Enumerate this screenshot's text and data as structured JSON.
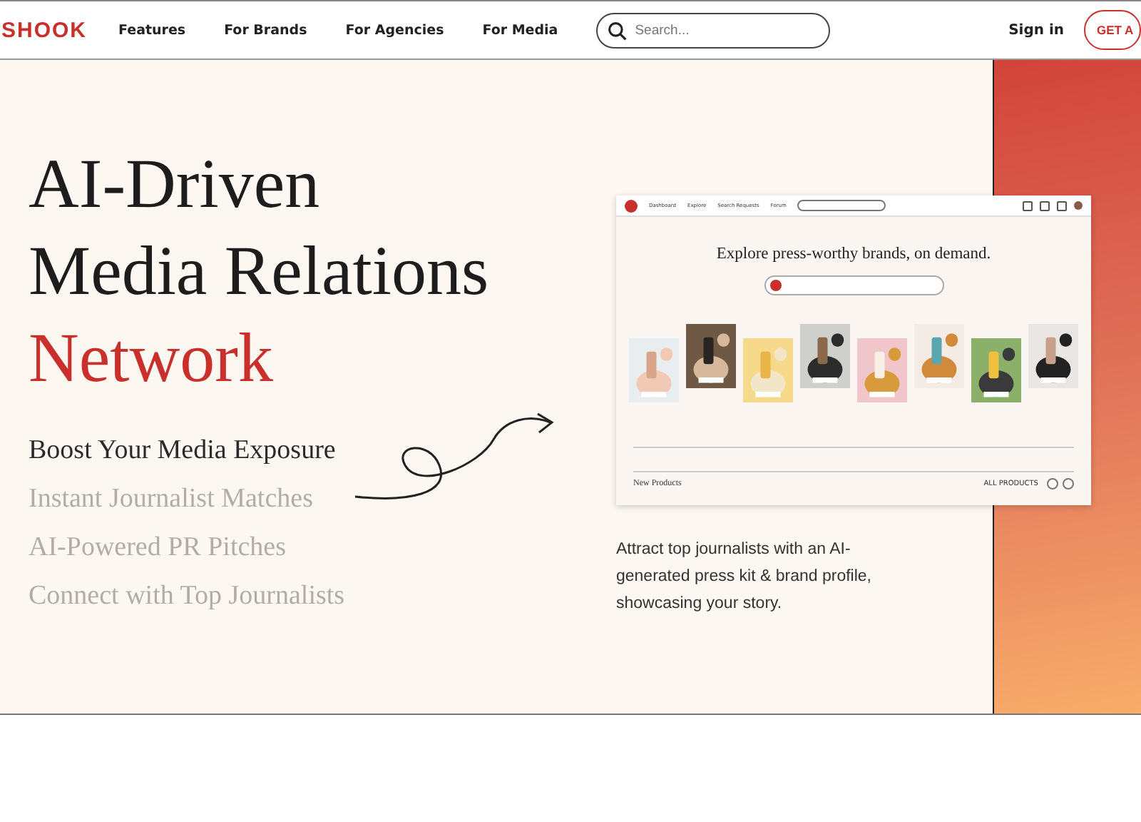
{
  "nav": {
    "logo": "SHOOK",
    "links": [
      {
        "label": "Features"
      },
      {
        "label": "For Brands"
      },
      {
        "label": "For Agencies"
      },
      {
        "label": "For Media"
      }
    ],
    "search": {
      "placeholder": "Search..."
    },
    "sign_in": "Sign in",
    "cta": "GET A"
  },
  "hero": {
    "title_lines": [
      "AI-Driven",
      "Media Relations"
    ],
    "title_accent": "Network",
    "features": [
      {
        "label": "Boost Your Media Exposure",
        "selected": true
      },
      {
        "label": "Instant Journalist Matches",
        "selected": false
      },
      {
        "label": "AI-Powered PR Pitches",
        "selected": false
      },
      {
        "label": "Connect with Top Journalists",
        "selected": false
      }
    ],
    "caption": "Attract top journalists with an AI-generated press kit & brand profile, showcasing your story."
  },
  "mock": {
    "nav": [
      {
        "label": "Dashboard"
      },
      {
        "label": "Explore"
      },
      {
        "label": "Search Requests"
      },
      {
        "label": "Forum"
      }
    ],
    "heading": "Explore press-worthy brands, on demand.",
    "section": "New Products",
    "all": "ALL PRODUCTS"
  }
}
